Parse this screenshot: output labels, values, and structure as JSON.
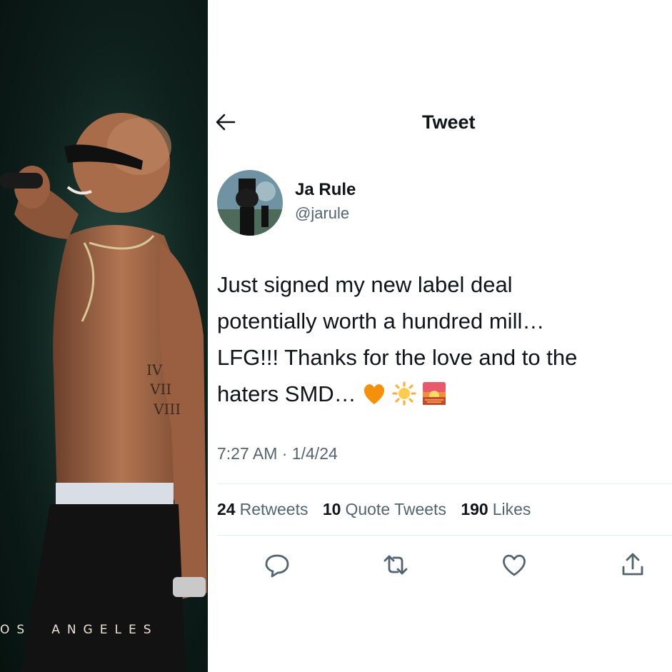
{
  "photo": {
    "caption_letters": [
      "O",
      "S",
      " ",
      "A",
      "N",
      "G",
      "E",
      "L",
      "E",
      "S"
    ]
  },
  "header": {
    "back_icon": "arrow-left-icon",
    "title": "Tweet"
  },
  "author": {
    "display_name": "Ja Rule",
    "handle": "@jarule",
    "avatar_icon": "profile-avatar"
  },
  "tweet": {
    "text": "Just signed my new label deal\npotentially worth a hundred mill…\nLFG!!! Thanks for the love and to the\nhaters SMD…",
    "emojis": [
      "orange-heart-icon",
      "sun-icon",
      "sunset-icon"
    ],
    "timestamp": "7:27 AM · 1/4/24"
  },
  "stats": {
    "retweets_count": "24",
    "retweets_label": "Retweets",
    "quotes_count": "10",
    "quotes_label": "Quote Tweets",
    "likes_count": "190",
    "likes_label": "Likes"
  },
  "actions": [
    "reply-icon",
    "retweet-icon",
    "like-icon",
    "share-icon"
  ],
  "colors": {
    "text_primary": "#0f1419",
    "text_secondary": "#536471",
    "divider": "#e6ecf0",
    "photo_background": "#0f211d"
  }
}
